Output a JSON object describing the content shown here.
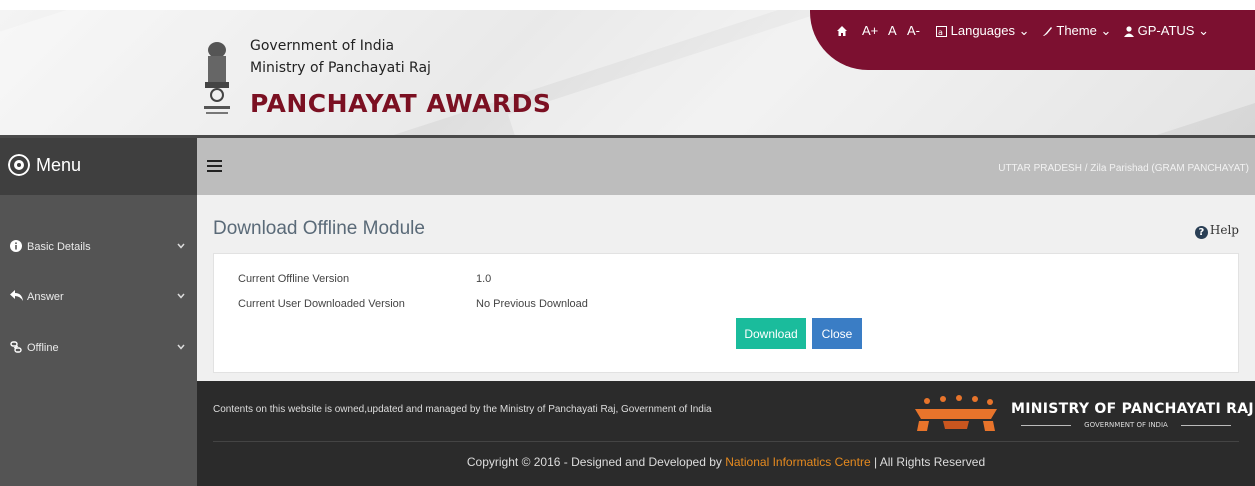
{
  "header": {
    "gov_line1": "Government of India",
    "gov_line2": "Ministry of Panchayati Raj",
    "brand": "PANCHAYAT AWARDS"
  },
  "topbar": {
    "font_increase": "A+",
    "font_normal": "A",
    "font_decrease": "A-",
    "languages": "Languages",
    "theme": "Theme",
    "user": "GP-ATUS",
    "accent_color": "#7c1030"
  },
  "sidebar": {
    "title": "Menu",
    "items": [
      {
        "label": "Basic Details",
        "icon": "info-circle-icon"
      },
      {
        "label": "Answer",
        "icon": "reply-icon"
      },
      {
        "label": "Offline",
        "icon": "chain-icon"
      }
    ]
  },
  "breadcrumb": "UTTAR PRADESH / Zila Parishad (GRAM PANCHAYAT)",
  "main": {
    "title": "Download Offline Module",
    "help": "Help",
    "rows": [
      {
        "label": "Current Offline Version",
        "value": "1.0"
      },
      {
        "label": "Current User Downloaded Version",
        "value": "No Previous Download"
      }
    ],
    "download_label": "Download",
    "close_label": "Close"
  },
  "footer": {
    "ownership": "Contents on this website is owned,updated and managed by the Ministry of Panchayati Raj, Government of India",
    "copyright_prefix": "Copyright © 2016 - Designed and Developed by ",
    "nic": "National Informatics Centre",
    "copyright_suffix": " | All Rights Reserved",
    "ministry_name": "MINISTRY OF PANCHAYATI RAJ",
    "ministry_sub": "GOVERNMENT OF INDIA"
  }
}
